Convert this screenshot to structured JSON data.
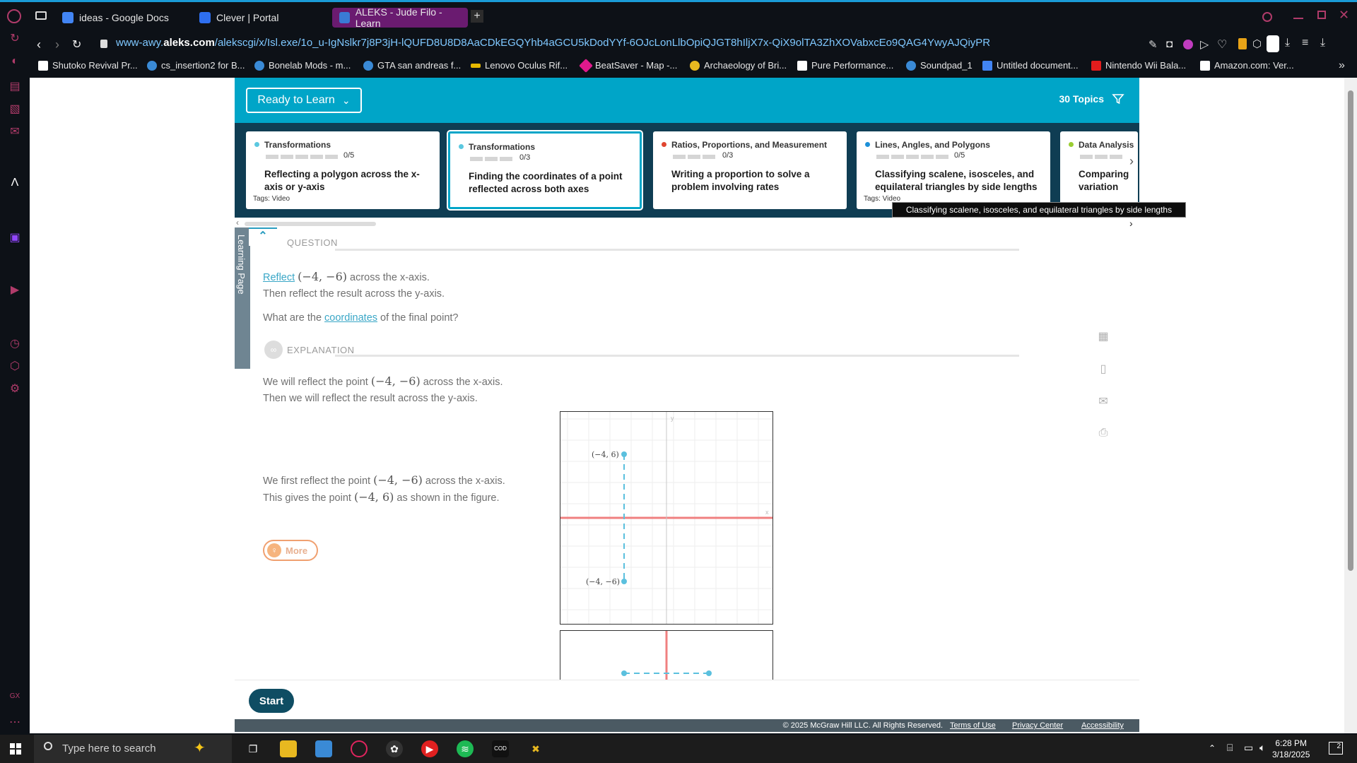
{
  "browser": {
    "tabs": [
      {
        "label": "ideas - Google Docs"
      },
      {
        "label": "Clever | Portal"
      },
      {
        "label": "ALEKS - Jude Filo - Learn"
      }
    ],
    "url_prefix": "www-awy.",
    "url_domain": "aleks.com",
    "url_path": "/alekscgi/x/Isl.exe/1o_u-IgNslkr7j8P3jH-lQUFD8U8D8AaCDkEGQYhb4aGCU5kDodYYf-6OJcLonLlbOpiQJGT8hIljX7x-QiX9olTA3ZhXOVabxcEo9QAG4YwyAJQiyPR",
    "bookmarks": [
      "Shutoko Revival Pr...",
      "cs_insertion2 for B...",
      "Bonelab Mods - m...",
      "GTA san andreas f...",
      "Lenovo Oculus Rif...",
      "BeatSaver - Map -...",
      "Archaeology of Bri...",
      "Pure Performance...",
      "Soundpad_1",
      "Untitled document...",
      "Nintendo Wii Bala...",
      "Amazon.com: Ver..."
    ]
  },
  "header": {
    "ready_label": "Ready to Learn",
    "topics_label": "30 Topics"
  },
  "cards": [
    {
      "category": "Transformations",
      "count": "0/5",
      "title": "Reflecting a polygon across the x-axis or y-axis",
      "tags": "Tags: Video",
      "dot_color": "#5bc8e0"
    },
    {
      "category": "Transformations",
      "count": "0/3",
      "title": "Finding the coordinates of a point reflected across both axes",
      "tags": "",
      "dot_color": "#5bc8e0"
    },
    {
      "category": "Ratios, Proportions, and Measurement",
      "count": "0/3",
      "title": "Writing a proportion to solve a problem involving rates",
      "tags": "",
      "dot_color": "#e0452f"
    },
    {
      "category": "Lines, Angles, and Polygons",
      "count": "0/5",
      "title": "Classifying scalene, isosceles, and equilateral triangles by side lengths",
      "tags": "Tags: Video",
      "dot_color": "#1d90d8"
    },
    {
      "category": "Data Analysis",
      "count": "",
      "title": "Comparing variation",
      "tags": "",
      "dot_color": "#9acd32"
    }
  ],
  "tooltip": "Classifying scalene, isosceles, and equilateral triangles by side lengths",
  "learning_page_label": "Learning Page",
  "question": {
    "label": "QUESTION",
    "reflect_link": "Reflect",
    "point": "(−4, −6)",
    "line1_rest": " across the x-axis.",
    "line2": "Then reflect the result across the y-axis.",
    "line3_pre": "What are the ",
    "coords_link": "coordinates",
    "line3_post": " of the final point?"
  },
  "explanation": {
    "label": "EXPLANATION",
    "p1_pre": "We will reflect the point ",
    "p1_point": "(−4, −6)",
    "p1_post": " across the x-axis.",
    "p2": "Then we will reflect the result across the y-axis.",
    "s1_pre": "We first reflect the point ",
    "s1_point": "(−4, −6)",
    "s1_post": " across the x-axis.",
    "s2_pre": "This gives the point ",
    "s2_point": "(−4, 6)",
    "s2_post": " as shown in the figure.",
    "more_label": "More"
  },
  "graph": {
    "point_top_label": "(−4, 6)",
    "point_bottom_label": "(−4, −6)",
    "axis_x": "x",
    "axis_y": "y"
  },
  "start_label": "Start",
  "footer": {
    "copyright": "© 2025 McGraw Hill LLC. All Rights Reserved.",
    "terms": "Terms of Use",
    "privacy": "Privacy Center",
    "accessibility": "Accessibility"
  },
  "taskbar": {
    "search_placeholder": "Type here to search",
    "time": "6:28 PM",
    "date": "3/18/2025",
    "notif_count": "2"
  },
  "colors": {
    "accent": "#00a5c8",
    "card_band": "#0f3d53",
    "browser_bg": "#0d1117",
    "active_tab": "#6a1b70"
  }
}
